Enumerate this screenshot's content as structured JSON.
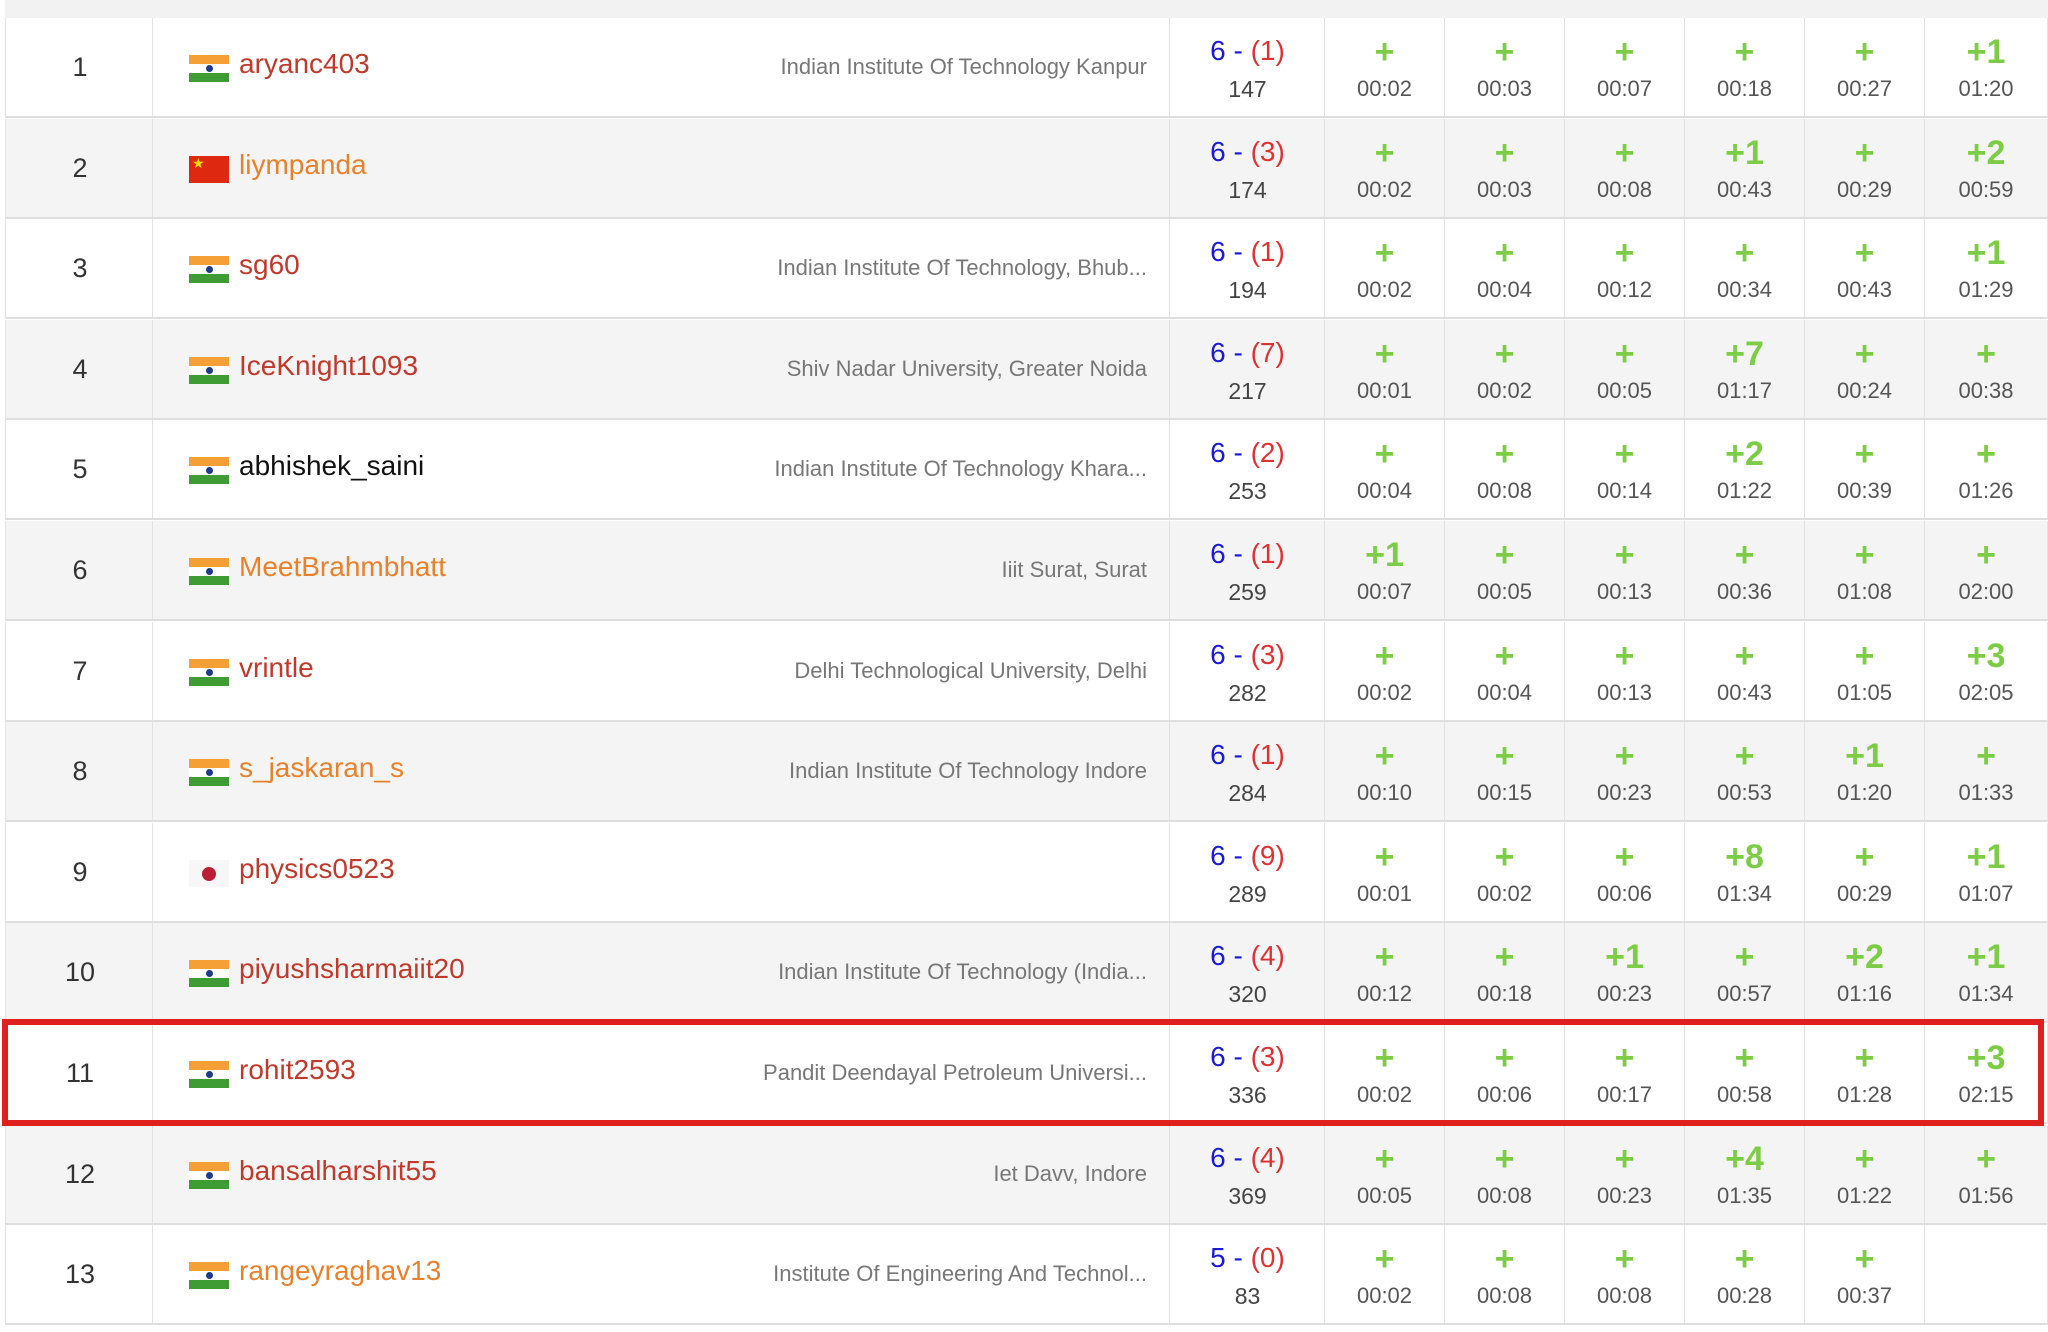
{
  "rows": [
    {
      "rank": "1",
      "flag": "in",
      "user": "aryanc403",
      "color": "red",
      "inst": "Indian Institute Of Technology Kanpur",
      "solved": "6",
      "penalty": "(1)",
      "time": "147",
      "problems": [
        [
          "+",
          "00:02"
        ],
        [
          "+",
          "00:03"
        ],
        [
          "+",
          "00:07"
        ],
        [
          "+",
          "00:18"
        ],
        [
          "+",
          "00:27"
        ],
        [
          "+1",
          "01:20"
        ]
      ]
    },
    {
      "rank": "2",
      "flag": "cn",
      "user": "liympanda",
      "color": "orange",
      "inst": "",
      "solved": "6",
      "penalty": "(3)",
      "time": "174",
      "problems": [
        [
          "+",
          "00:02"
        ],
        [
          "+",
          "00:03"
        ],
        [
          "+",
          "00:08"
        ],
        [
          "+1",
          "00:43"
        ],
        [
          "+",
          "00:29"
        ],
        [
          "+2",
          "00:59"
        ]
      ]
    },
    {
      "rank": "3",
      "flag": "in",
      "user": "sg60",
      "color": "red",
      "inst": "Indian Institute Of Technology, Bhub...",
      "solved": "6",
      "penalty": "(1)",
      "time": "194",
      "problems": [
        [
          "+",
          "00:02"
        ],
        [
          "+",
          "00:04"
        ],
        [
          "+",
          "00:12"
        ],
        [
          "+",
          "00:34"
        ],
        [
          "+",
          "00:43"
        ],
        [
          "+1",
          "01:29"
        ]
      ]
    },
    {
      "rank": "4",
      "flag": "in",
      "user": "IceKnight1093",
      "color": "red",
      "inst": "Shiv Nadar University, Greater Noida",
      "solved": "6",
      "penalty": "(7)",
      "time": "217",
      "problems": [
        [
          "+",
          "00:01"
        ],
        [
          "+",
          "00:02"
        ],
        [
          "+",
          "00:05"
        ],
        [
          "+7",
          "01:17"
        ],
        [
          "+",
          "00:24"
        ],
        [
          "+",
          "00:38"
        ]
      ]
    },
    {
      "rank": "5",
      "flag": "in",
      "user": "abhishek_saini",
      "color": "black",
      "inst": "Indian Institute Of Technology Khara...",
      "solved": "6",
      "penalty": "(2)",
      "time": "253",
      "problems": [
        [
          "+",
          "00:04"
        ],
        [
          "+",
          "00:08"
        ],
        [
          "+",
          "00:14"
        ],
        [
          "+2",
          "01:22"
        ],
        [
          "+",
          "00:39"
        ],
        [
          "+",
          "01:26"
        ]
      ]
    },
    {
      "rank": "6",
      "flag": "in",
      "user": "MeetBrahmbhatt",
      "color": "orange",
      "inst": "Iiit Surat, Surat",
      "solved": "6",
      "penalty": "(1)",
      "time": "259",
      "problems": [
        [
          "+1",
          "00:07"
        ],
        [
          "+",
          "00:05"
        ],
        [
          "+",
          "00:13"
        ],
        [
          "+",
          "00:36"
        ],
        [
          "+",
          "01:08"
        ],
        [
          "+",
          "02:00"
        ]
      ]
    },
    {
      "rank": "7",
      "flag": "in",
      "user": "vrintle",
      "color": "red",
      "inst": "Delhi Technological University, Delhi",
      "solved": "6",
      "penalty": "(3)",
      "time": "282",
      "problems": [
        [
          "+",
          "00:02"
        ],
        [
          "+",
          "00:04"
        ],
        [
          "+",
          "00:13"
        ],
        [
          "+",
          "00:43"
        ],
        [
          "+",
          "01:05"
        ],
        [
          "+3",
          "02:05"
        ]
      ]
    },
    {
      "rank": "8",
      "flag": "in",
      "user": "s_jaskaran_s",
      "color": "orange",
      "inst": "Indian Institute Of Technology Indore",
      "solved": "6",
      "penalty": "(1)",
      "time": "284",
      "problems": [
        [
          "+",
          "00:10"
        ],
        [
          "+",
          "00:15"
        ],
        [
          "+",
          "00:23"
        ],
        [
          "+",
          "00:53"
        ],
        [
          "+1",
          "01:20"
        ],
        [
          "+",
          "01:33"
        ]
      ]
    },
    {
      "rank": "9",
      "flag": "jp",
      "user": "physics0523",
      "color": "red",
      "inst": "",
      "solved": "6",
      "penalty": "(9)",
      "time": "289",
      "problems": [
        [
          "+",
          "00:01"
        ],
        [
          "+",
          "00:02"
        ],
        [
          "+",
          "00:06"
        ],
        [
          "+8",
          "01:34"
        ],
        [
          "+",
          "00:29"
        ],
        [
          "+1",
          "01:07"
        ]
      ]
    },
    {
      "rank": "10",
      "flag": "in",
      "user": "piyushsharmaiit20",
      "color": "red",
      "inst": "Indian Institute Of Technology (India...",
      "solved": "6",
      "penalty": "(4)",
      "time": "320",
      "problems": [
        [
          "+",
          "00:12"
        ],
        [
          "+",
          "00:18"
        ],
        [
          "+1",
          "00:23"
        ],
        [
          "+",
          "00:57"
        ],
        [
          "+2",
          "01:16"
        ],
        [
          "+1",
          "01:34"
        ]
      ]
    },
    {
      "rank": "11",
      "flag": "in",
      "user": "rohit2593",
      "color": "red",
      "inst": "Pandit Deendayal Petroleum Universi...",
      "solved": "6",
      "penalty": "(3)",
      "time": "336",
      "problems": [
        [
          "+",
          "00:02"
        ],
        [
          "+",
          "00:06"
        ],
        [
          "+",
          "00:17"
        ],
        [
          "+",
          "00:58"
        ],
        [
          "+",
          "01:28"
        ],
        [
          "+3",
          "02:15"
        ]
      ]
    },
    {
      "rank": "12",
      "flag": "in",
      "user": "bansalharshit55",
      "color": "red",
      "inst": "Iet Davv, Indore",
      "solved": "6",
      "penalty": "(4)",
      "time": "369",
      "problems": [
        [
          "+",
          "00:05"
        ],
        [
          "+",
          "00:08"
        ],
        [
          "+",
          "00:23"
        ],
        [
          "+4",
          "01:35"
        ],
        [
          "+",
          "01:22"
        ],
        [
          "+",
          "01:56"
        ]
      ]
    },
    {
      "rank": "13",
      "flag": "in",
      "user": "rangeyraghav13",
      "color": "orange",
      "inst": "Institute Of Engineering And Technol...",
      "solved": "5",
      "penalty": "(0)",
      "time": "83",
      "problems": [
        [
          "+",
          "00:02"
        ],
        [
          "+",
          "00:08"
        ],
        [
          "+",
          "00:08"
        ],
        [
          "+",
          "00:28"
        ],
        [
          "+",
          "00:37"
        ],
        [
          "",
          ""
        ]
      ]
    }
  ],
  "dash": "-",
  "highlight_rank": "11",
  "colors": {
    "accept": "#7ccd45",
    "solved": "#1a1ad6",
    "penalty": "#e03131",
    "highlight": "#e01f1f"
  }
}
